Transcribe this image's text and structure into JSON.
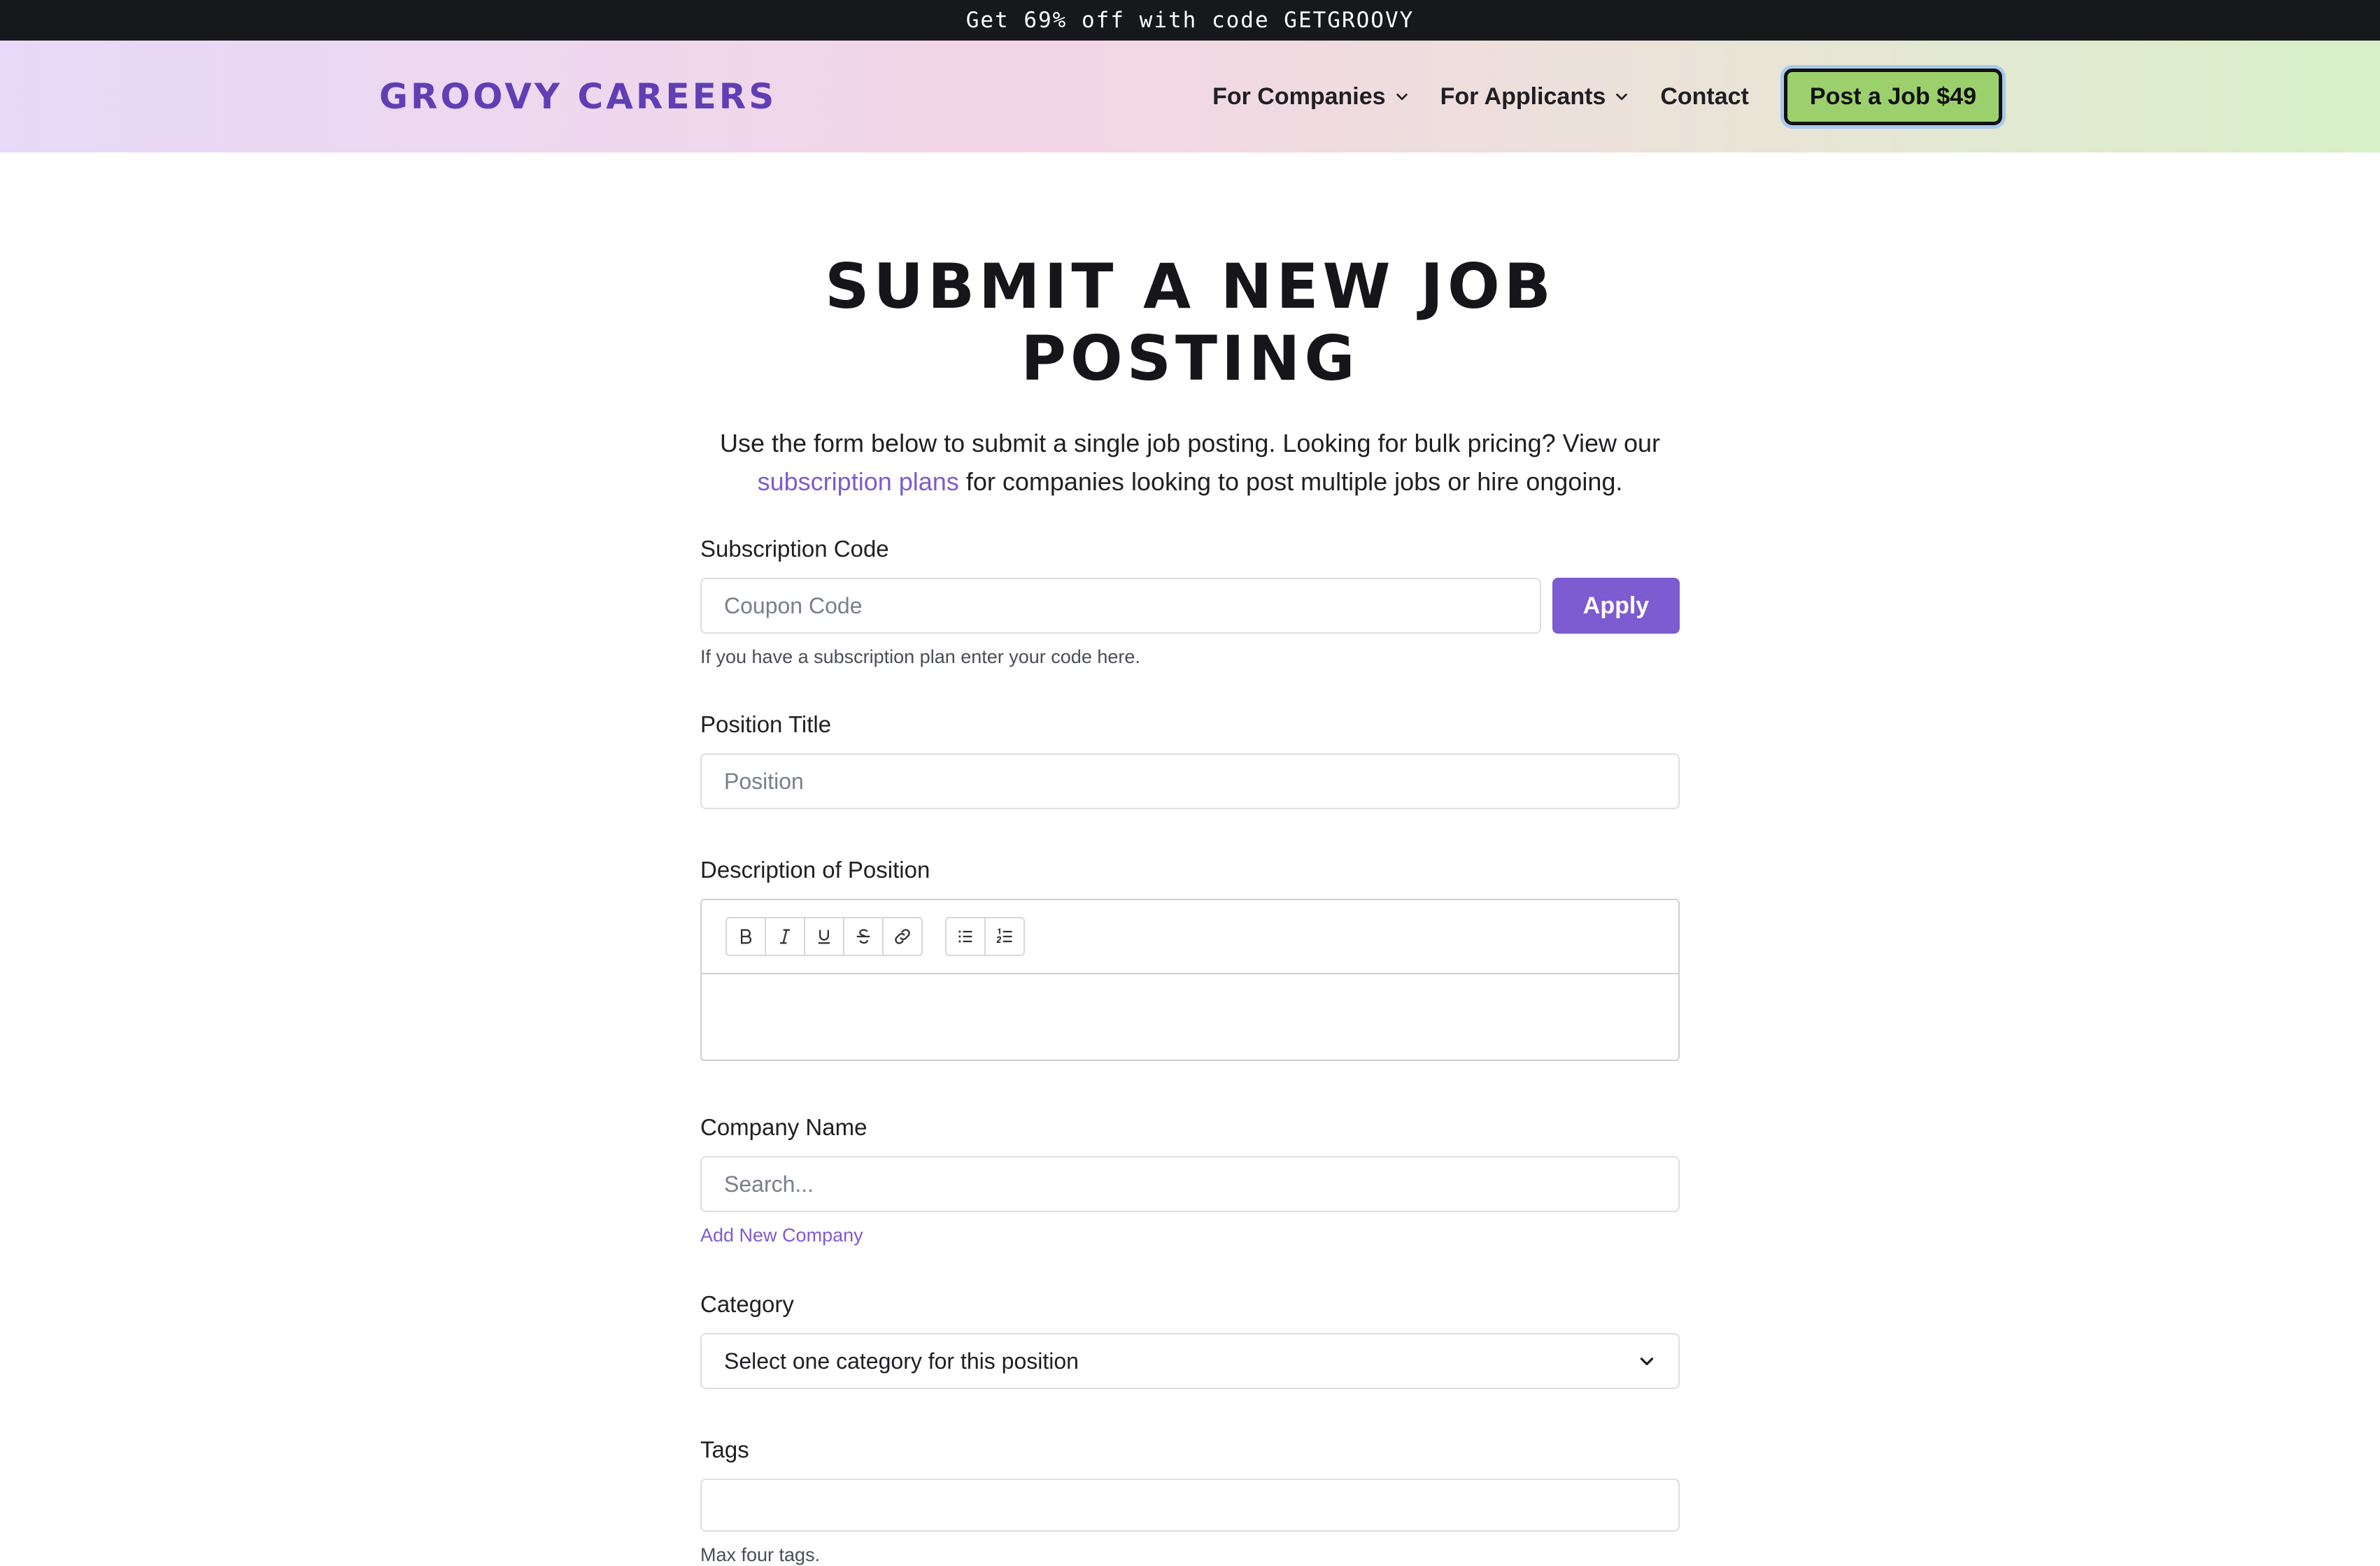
{
  "promo": {
    "text": "Get 69% off with code GETGROOVY"
  },
  "header": {
    "logo": "GROOVY CAREERS",
    "nav": [
      {
        "label": "For Companies",
        "has_dropdown": true
      },
      {
        "label": "For Applicants",
        "has_dropdown": true
      },
      {
        "label": "Contact",
        "has_dropdown": false
      }
    ],
    "cta_label": "Post a Job $49"
  },
  "main": {
    "title": "SUBMIT A NEW JOB POSTING",
    "intro_before": "Use the form below to submit a single job posting. Looking for bulk pricing? View our",
    "intro_link": "subscription plans",
    "intro_after": "for companies looking to post multiple jobs or hire ongoing."
  },
  "form": {
    "subscription": {
      "label": "Subscription Code",
      "placeholder": "Coupon Code",
      "button": "Apply",
      "help": "If you have a subscription plan enter your code here."
    },
    "position": {
      "label": "Position Title",
      "placeholder": "Position"
    },
    "description": {
      "label": "Description of Position",
      "toolbar": [
        "bold-icon",
        "italic-icon",
        "underline-icon",
        "strikethrough-icon",
        "link-icon",
        "bullet-list-icon",
        "numbered-list-icon"
      ]
    },
    "company": {
      "label": "Company Name",
      "placeholder": "Search...",
      "add_link": "Add New Company"
    },
    "category": {
      "label": "Category",
      "selected": "Select one category for this position"
    },
    "tags": {
      "label": "Tags",
      "help": "Max four tags."
    }
  },
  "colors": {
    "accent": "#7d5bd0",
    "cta_background": "#9bd06c",
    "promo_background": "#17181b"
  }
}
